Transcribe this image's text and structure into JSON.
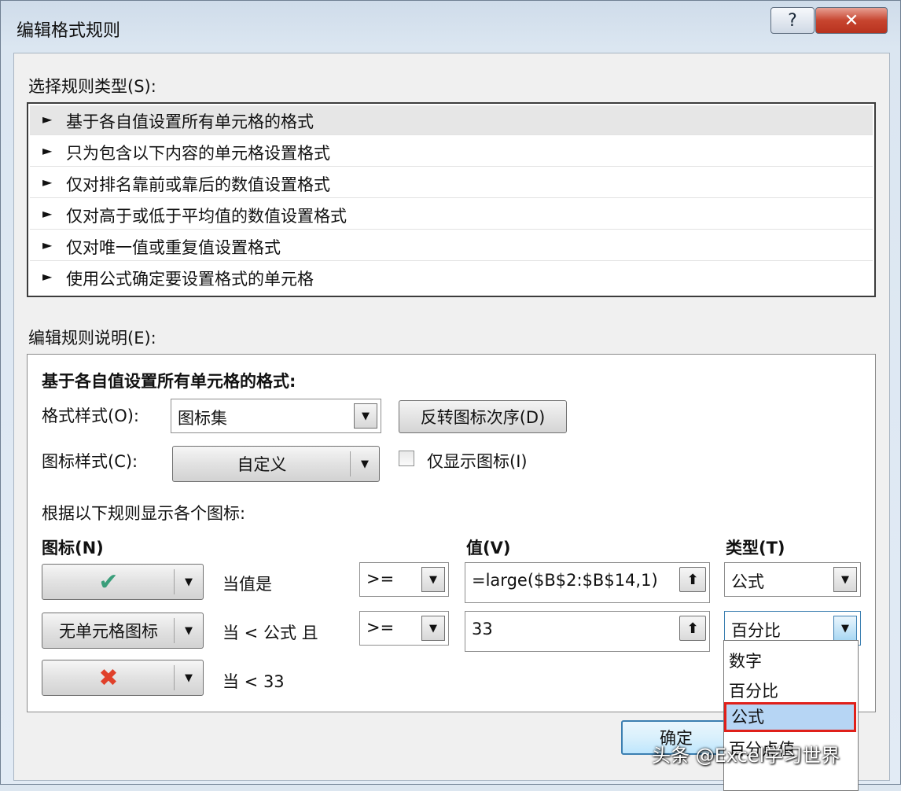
{
  "window": {
    "title": "编辑格式规则",
    "help_label": "?",
    "close_label": "✕"
  },
  "rule_type": {
    "label": "选择规则类型(S):",
    "items": [
      {
        "label": "基于各自值设置所有单元格的格式",
        "selected": true
      },
      {
        "label": "只为包含以下内容的单元格设置格式",
        "selected": false
      },
      {
        "label": "仅对排名靠前或靠后的数值设置格式",
        "selected": false
      },
      {
        "label": "仅对高于或低于平均值的数值设置格式",
        "selected": false
      },
      {
        "label": "仅对唯一值或重复值设置格式",
        "selected": false
      },
      {
        "label": "使用公式确定要设置格式的单元格",
        "selected": false
      }
    ],
    "arrow": "►"
  },
  "edit_rule": {
    "label": "编辑规则说明(E):",
    "heading": "基于各自值设置所有单元格的格式:",
    "format_style_label": "格式样式(O):",
    "format_style_value": "图标集",
    "reverse_button": "反转图标次序(D)",
    "icon_style_label": "图标样式(C):",
    "icon_style_value": "自定义",
    "show_icon_only_label": "仅显示图标(I)",
    "show_icon_only_checked": false,
    "rules_intro": "根据以下规则显示各个图标:",
    "col_icon": "图标(N)",
    "col_value": "值(V)",
    "col_type": "类型(T)",
    "rows": [
      {
        "icon": "✔",
        "icon_name": "check-icon",
        "icon_color": "#3a9e7a",
        "condition": "当值是",
        "operator": ">=",
        "value": "=large($B$2:$B$14,1)",
        "type": "公式"
      },
      {
        "icon": "无单元格图标",
        "icon_name": "no-icon",
        "condition": "当 < 公式 且",
        "operator": ">=",
        "value": "33",
        "type": "百分比"
      },
      {
        "icon": "✖",
        "icon_name": "cross-icon",
        "icon_color": "#e0402a",
        "condition": "当 < 33"
      }
    ],
    "type_options": [
      "数字",
      "百分比",
      "公式",
      "百分点值"
    ],
    "highlighted_option": "公式"
  },
  "buttons": {
    "ok": "确定"
  },
  "watermark": "头条 @Excel学习世界",
  "colors": {
    "selection_highlight": "#b6d5f4",
    "annotation_border": "#e0201a"
  }
}
